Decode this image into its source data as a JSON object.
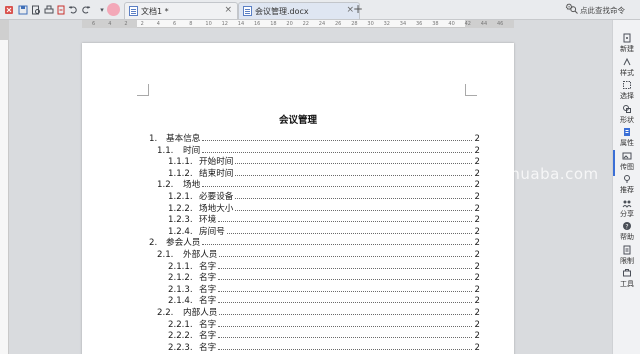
{
  "quick_access": {
    "icons": [
      "wps-logo-icon",
      "save-icon",
      "print-preview-icon",
      "print-icon",
      "export-pdf-icon",
      "undo-icon",
      "redo-icon",
      "dropdown-icon"
    ]
  },
  "tabs": [
    {
      "label": "文档1 *",
      "close": "×"
    },
    {
      "label": "会议管理.docx",
      "close": "×"
    }
  ],
  "new_tab": "+",
  "search_label": "点此查找命令",
  "ruler_numbers": [
    "6",
    "4",
    "2",
    "2",
    "4",
    "6",
    "8",
    "10",
    "12",
    "14",
    "16",
    "18",
    "20",
    "22",
    "24",
    "26",
    "28",
    "30",
    "32",
    "34",
    "36",
    "38",
    "40",
    "42",
    "44",
    "46"
  ],
  "document": {
    "title": "会议管理",
    "toc": [
      {
        "num": "1.",
        "text": "基本信息",
        "page": "2",
        "level": 1
      },
      {
        "num": "1.1.",
        "text": "时间",
        "page": "2",
        "level": 2
      },
      {
        "num": "1.1.1.",
        "text": "开始时间",
        "page": "2",
        "level": 3
      },
      {
        "num": "1.1.2.",
        "text": "结束时间",
        "page": "2",
        "level": 3
      },
      {
        "num": "1.2.",
        "text": "场地",
        "page": "2",
        "level": 2
      },
      {
        "num": "1.2.1.",
        "text": "必要设备",
        "page": "2",
        "level": 3
      },
      {
        "num": "1.2.2.",
        "text": "场地大小",
        "page": "2",
        "level": 3
      },
      {
        "num": "1.2.3.",
        "text": "环境",
        "page": "2",
        "level": 3
      },
      {
        "num": "1.2.4.",
        "text": "房间号",
        "page": "2",
        "level": 3
      },
      {
        "num": "2.",
        "text": "参会人员",
        "page": "2",
        "level": 1
      },
      {
        "num": "2.1.",
        "text": "外部人员",
        "page": "2",
        "level": 2
      },
      {
        "num": "2.1.1.",
        "text": "名字",
        "page": "2",
        "level": 3
      },
      {
        "num": "2.1.2.",
        "text": "名字",
        "page": "2",
        "level": 3
      },
      {
        "num": "2.1.3.",
        "text": "名字",
        "page": "2",
        "level": 3
      },
      {
        "num": "2.1.4.",
        "text": "名字",
        "page": "2",
        "level": 3
      },
      {
        "num": "2.2.",
        "text": "内部人员",
        "page": "2",
        "level": 2
      },
      {
        "num": "2.2.1.",
        "text": "名字",
        "page": "2",
        "level": 3
      },
      {
        "num": "2.2.2.",
        "text": "名字",
        "page": "2",
        "level": 3
      },
      {
        "num": "2.2.3.",
        "text": "名字",
        "page": "2",
        "level": 3
      }
    ]
  },
  "sidebar": [
    {
      "label": "新建",
      "icon": "new-icon"
    },
    {
      "label": "样式",
      "icon": "style-icon"
    },
    {
      "label": "选择",
      "icon": "select-icon"
    },
    {
      "label": "形状",
      "icon": "shape-icon"
    },
    {
      "label": "属性",
      "icon": "properties-icon"
    },
    {
      "label": "传图",
      "icon": "upload-image-icon"
    },
    {
      "label": "推荐",
      "icon": "recommend-icon"
    },
    {
      "label": "分享",
      "icon": "share-icon"
    },
    {
      "label": "帮助",
      "icon": "help-icon"
    },
    {
      "label": "限制",
      "icon": "restrict-icon"
    },
    {
      "label": "工具",
      "icon": "tools-icon"
    }
  ],
  "watermark": "tuhuaba.com",
  "colors": {
    "accent": "#3b6fd6",
    "tab_active": "#dfe6f2",
    "page": "#ffffff",
    "workspace": "#d9dbde"
  }
}
